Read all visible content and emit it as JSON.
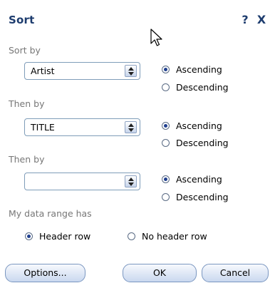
{
  "window": {
    "title": "Sort",
    "help_label": "?",
    "close_label": "X"
  },
  "sort_by": {
    "label": "Sort by",
    "value": "Artist",
    "ascending": "Ascending",
    "descending": "Descending",
    "selected": "ascending"
  },
  "then_by_1": {
    "label": "Then by",
    "value": "TITLE",
    "ascending": "Ascending",
    "descending": "Descending",
    "selected": "ascending"
  },
  "then_by_2": {
    "label": "Then by",
    "value": "",
    "ascending": "Ascending",
    "descending": "Descending",
    "selected": "ascending"
  },
  "data_range": {
    "label": "My data range has",
    "header_row": "Header row",
    "no_header_row": "No header row",
    "selected": "header_row"
  },
  "buttons": {
    "options": "Options...",
    "ok": "OK",
    "cancel": "Cancel"
  },
  "colors": {
    "title": "#1d3c6e",
    "section_label": "#777777",
    "button_gradient_bottom": "#c9d8ef"
  }
}
